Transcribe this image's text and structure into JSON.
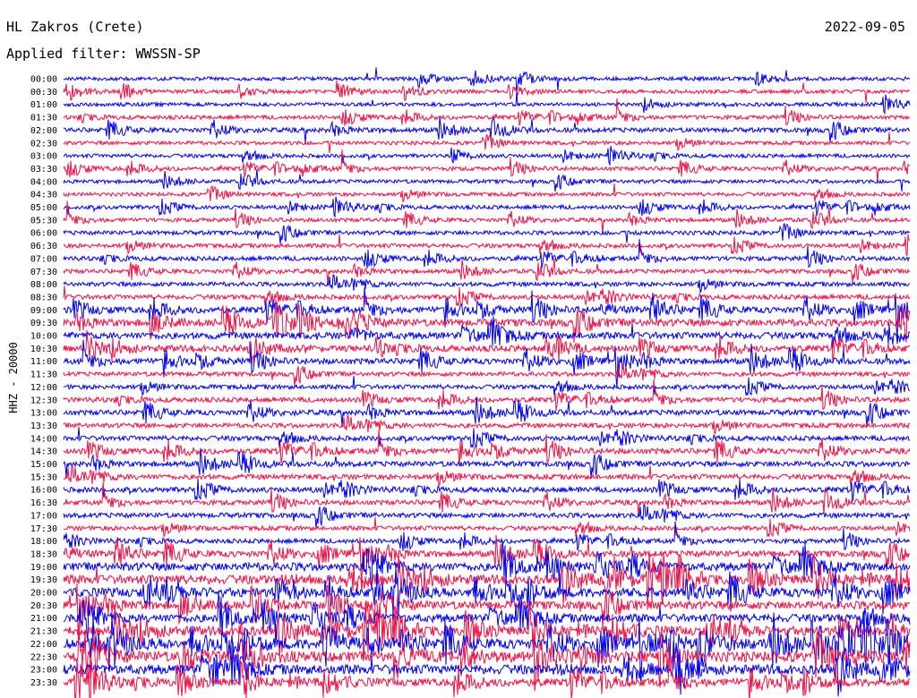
{
  "header": {
    "station": "HL Zakros (Crete)",
    "date": "2022-09-05",
    "filter": "Applied filter: WWSSN-SP"
  },
  "chart_data": {
    "type": "line",
    "channel_label": "HHZ - 20000",
    "row_labels": [
      "00:00",
      "00:30",
      "01:00",
      "01:30",
      "02:00",
      "02:30",
      "03:00",
      "03:30",
      "04:00",
      "04:30",
      "05:00",
      "05:30",
      "06:00",
      "06:30",
      "07:00",
      "07:30",
      "08:00",
      "08:30",
      "09:00",
      "09:30",
      "10:00",
      "10:30",
      "11:00",
      "11:30",
      "12:00",
      "12:30",
      "13:00",
      "13:30",
      "14:00",
      "14:30",
      "15:00",
      "15:30",
      "16:00",
      "16:30",
      "17:00",
      "17:30",
      "18:00",
      "18:30",
      "19:00",
      "19:30",
      "20:00",
      "20:30",
      "21:00",
      "21:30",
      "22:00",
      "22:30",
      "23:00",
      "23:30"
    ],
    "series_colors": [
      "#0000ee",
      "#ee1144"
    ],
    "trace_count": 48,
    "activity_profile": [
      0.35,
      0.35,
      0.35,
      0.4,
      0.55,
      0.35,
      0.35,
      0.4,
      0.35,
      0.35,
      0.4,
      0.4,
      0.45,
      0.45,
      0.5,
      0.45,
      0.5,
      0.55,
      0.9,
      1.1,
      1.0,
      0.9,
      0.8,
      0.5,
      0.5,
      0.6,
      0.7,
      0.55,
      0.6,
      0.75,
      0.7,
      0.65,
      0.7,
      0.6,
      0.6,
      0.5,
      0.5,
      0.9,
      1.3,
      1.5,
      1.5,
      1.3,
      1.3,
      1.5,
      1.7,
      1.8,
      1.6,
      1.2
    ]
  }
}
